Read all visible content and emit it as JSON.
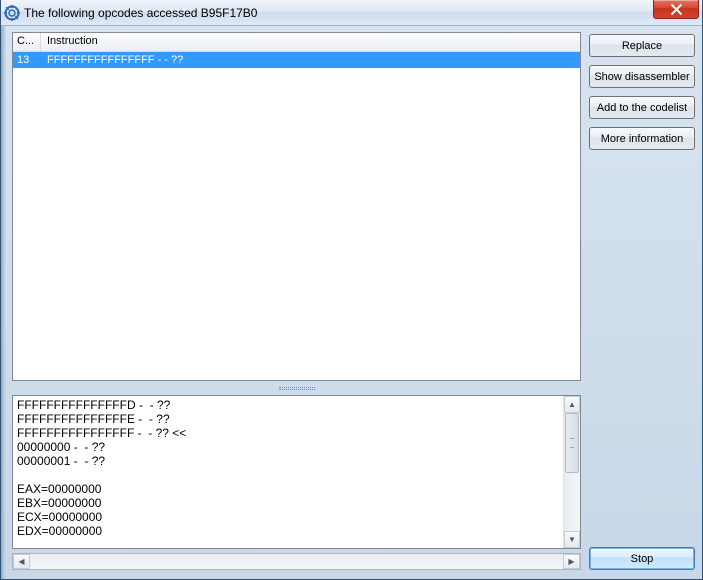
{
  "window": {
    "title": "The following opcodes accessed B95F17B0"
  },
  "list": {
    "columns": {
      "count": "C...",
      "instruction": "Instruction"
    },
    "rows": [
      {
        "count": "13",
        "instruction": "FFFFFFFFFFFFFFFF -  - ??"
      }
    ]
  },
  "details": {
    "lines": [
      "FFFFFFFFFFFFFFFD -  - ??",
      "FFFFFFFFFFFFFFFE -  - ??",
      "FFFFFFFFFFFFFFFF -  - ?? <<",
      "00000000 -  - ??",
      "00000001 -  - ??",
      "",
      "EAX=00000000",
      "EBX=00000000",
      "ECX=00000000",
      "EDX=00000000"
    ]
  },
  "buttons": {
    "replace": "Replace",
    "show_disassembler": "Show disassembler",
    "add_to_codelist": "Add to the codelist",
    "more_information": "More information",
    "stop": "Stop"
  }
}
